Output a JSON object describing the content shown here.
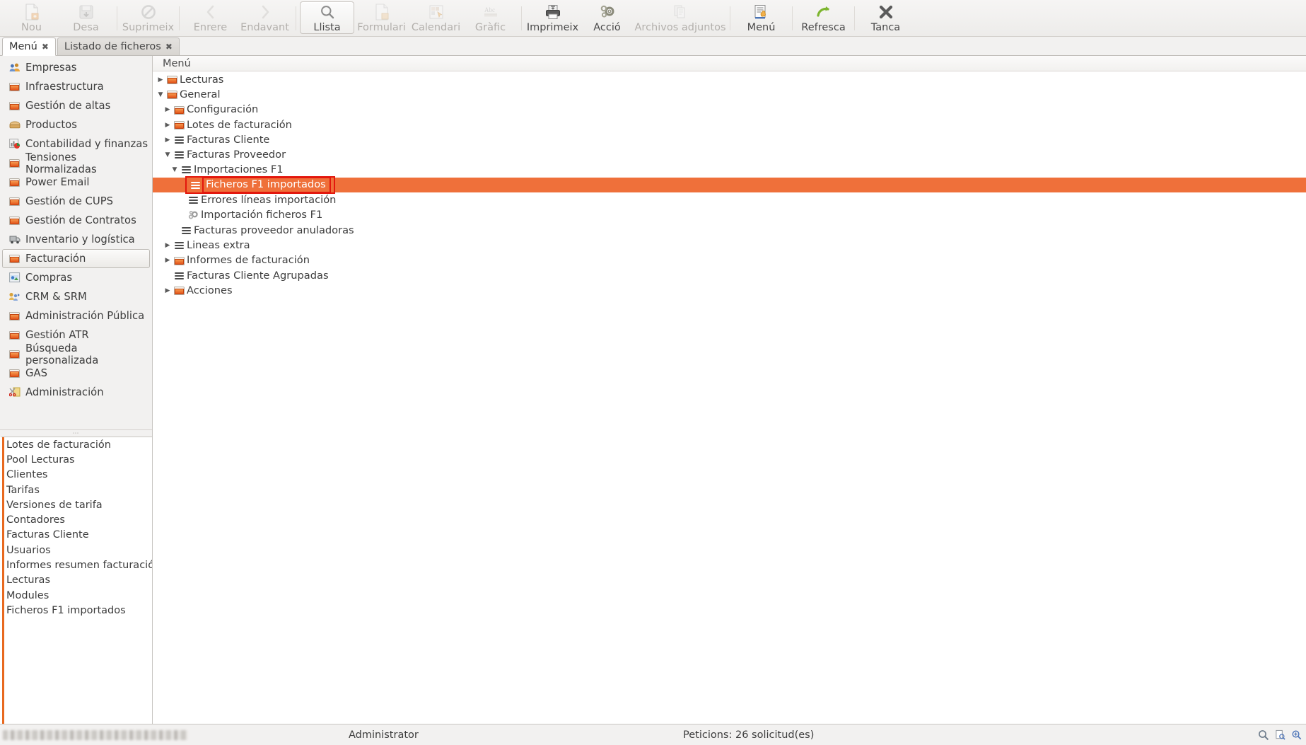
{
  "toolbar": {
    "items": [
      {
        "label": "Nou",
        "icon": "new-document-icon",
        "state": "disabled"
      },
      {
        "label": "Desa",
        "icon": "save-icon",
        "state": "disabled"
      },
      {
        "sep": true
      },
      {
        "label": "Suprimeix",
        "icon": "delete-forbidden-icon",
        "state": "disabled"
      },
      {
        "sep": true
      },
      {
        "label": "Enrere",
        "icon": "chevron-left-icon",
        "state": "disabled"
      },
      {
        "label": "Endavant",
        "icon": "chevron-right-icon",
        "state": "disabled"
      },
      {
        "sep": true
      },
      {
        "label": "Llista",
        "icon": "search-list-icon",
        "state": "active"
      },
      {
        "label": "Formulari",
        "icon": "form-icon",
        "state": "disabled"
      },
      {
        "label": "Calendari",
        "icon": "calendar-icon",
        "state": "disabled"
      },
      {
        "label": "Gràfic",
        "icon": "chart-abc-icon",
        "state": "disabled"
      },
      {
        "sep": true
      },
      {
        "label": "Imprimeix",
        "icon": "printer-icon",
        "state": "enabled"
      },
      {
        "label": "Acció",
        "icon": "gears-icon",
        "state": "enabled"
      },
      {
        "label": "Archivos adjuntos",
        "icon": "attachments-icon",
        "state": "disabled"
      },
      {
        "sep": true
      },
      {
        "label": "Menú",
        "icon": "menu-document-icon",
        "state": "enabled"
      },
      {
        "sep": true
      },
      {
        "label": "Refresca",
        "icon": "refresh-arrow-icon",
        "state": "enabled"
      },
      {
        "sep": true
      },
      {
        "label": "Tanca",
        "icon": "close-x-icon",
        "state": "enabled"
      }
    ]
  },
  "tabs": [
    {
      "label": "Menú",
      "active": true,
      "close": "✖"
    },
    {
      "label": "Listado de ficheros",
      "active": false,
      "close": "✖"
    }
  ],
  "sidebar": {
    "items": [
      {
        "label": "Empresas",
        "icon": "people-icon",
        "selected": false
      },
      {
        "label": "Infraestructura",
        "icon": "folder-icon",
        "selected": false
      },
      {
        "label": "Gestión de altas",
        "icon": "folder-icon",
        "selected": false
      },
      {
        "label": "Productos",
        "icon": "package-icon",
        "selected": false
      },
      {
        "label": "Contabilidad y finanzas",
        "icon": "chart-pie-icon",
        "selected": false
      },
      {
        "label": "Tensiones Normalizadas",
        "icon": "folder-icon",
        "selected": false
      },
      {
        "label": "Power Email",
        "icon": "folder-icon",
        "selected": false
      },
      {
        "label": "Gestión de CUPS",
        "icon": "folder-icon",
        "selected": false
      },
      {
        "label": "Gestión de Contratos",
        "icon": "folder-icon",
        "selected": false
      },
      {
        "label": "Inventario y logística",
        "icon": "truck-icon",
        "selected": false
      },
      {
        "label": "Facturación",
        "icon": "folder-icon",
        "selected": true
      },
      {
        "label": "Compras",
        "icon": "cart-icon",
        "selected": false
      },
      {
        "label": "CRM & SRM",
        "icon": "crm-icon",
        "selected": false
      },
      {
        "label": "Administración Pública",
        "icon": "folder-icon",
        "selected": false
      },
      {
        "label": "Gestión ATR",
        "icon": "folder-icon",
        "selected": false
      },
      {
        "label": "Búsqueda personalizada",
        "icon": "folder-icon",
        "selected": false
      },
      {
        "label": "GAS",
        "icon": "folder-icon",
        "selected": false
      },
      {
        "label": "Administración",
        "icon": "scissors-icon",
        "selected": false
      }
    ],
    "shortcuts": [
      {
        "label": "Lotes de facturación"
      },
      {
        "label": "Pool Lecturas"
      },
      {
        "label": "Clientes"
      },
      {
        "label": "Tarifas"
      },
      {
        "label": "Versiones de tarifa"
      },
      {
        "label": "Contadores"
      },
      {
        "label": "Facturas Cliente"
      },
      {
        "label": "Usuarios"
      },
      {
        "label": "Informes resumen facturación"
      },
      {
        "label": "Lecturas"
      },
      {
        "label": "Modules"
      },
      {
        "label": "Ficheros F1 importados"
      }
    ]
  },
  "tree": {
    "header": "Menú",
    "nodes": [
      {
        "label": "Lecturas",
        "depth": 0,
        "icon": "folder-icon",
        "expander": "collapsed",
        "selected": false
      },
      {
        "label": "General",
        "depth": 0,
        "icon": "folder-icon",
        "expander": "expanded",
        "selected": false
      },
      {
        "label": "Configuración",
        "depth": 1,
        "icon": "folder-icon",
        "expander": "collapsed",
        "selected": false
      },
      {
        "label": "Lotes de facturación",
        "depth": 1,
        "icon": "folder-icon",
        "expander": "collapsed",
        "selected": false
      },
      {
        "label": "Facturas Cliente",
        "depth": 1,
        "icon": "list-icon",
        "expander": "collapsed",
        "selected": false
      },
      {
        "label": "Facturas Proveedor",
        "depth": 1,
        "icon": "list-icon",
        "expander": "expanded",
        "selected": false
      },
      {
        "label": "Importaciones F1",
        "depth": 2,
        "icon": "list-icon",
        "expander": "expanded",
        "selected": false
      },
      {
        "label": "Ficheros F1 importados",
        "depth": 3,
        "icon": "list-icon",
        "expander": "none",
        "selected": true
      },
      {
        "label": "Errores líneas importación",
        "depth": 3,
        "icon": "list-icon",
        "expander": "none",
        "selected": false
      },
      {
        "label": "Importación ficheros F1",
        "depth": 3,
        "icon": "gears-small-icon",
        "expander": "none",
        "selected": false
      },
      {
        "label": "Facturas proveedor anuladoras",
        "depth": 2,
        "icon": "list-icon",
        "expander": "none",
        "selected": false
      },
      {
        "label": "Lineas extra",
        "depth": 1,
        "icon": "list-icon",
        "expander": "collapsed",
        "selected": false
      },
      {
        "label": "Informes de facturación",
        "depth": 1,
        "icon": "folder-icon",
        "expander": "collapsed",
        "selected": false
      },
      {
        "label": "Facturas Cliente Agrupadas",
        "depth": 1,
        "icon": "list-icon",
        "expander": "none",
        "selected": false
      },
      {
        "label": "Acciones",
        "depth": 1,
        "icon": "folder-icon",
        "expander": "collapsed",
        "selected": false
      }
    ]
  },
  "statusbar": {
    "user": "Administrator",
    "requests": "Peticions:  26 solicitud(es)"
  },
  "colors": {
    "selection": "#ef703a",
    "selection_outline": "#e3170d",
    "accent": "#e8691f",
    "chrome": "#f2f1f0"
  }
}
